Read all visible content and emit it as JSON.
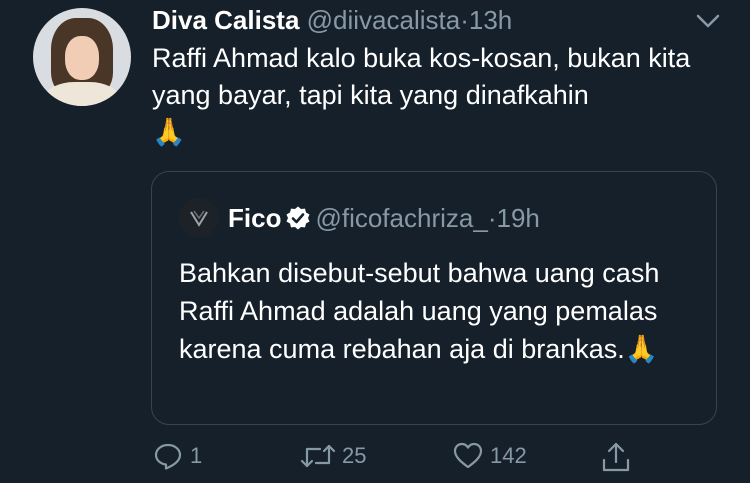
{
  "tweet": {
    "author_name": "Diva Calista",
    "author_handle": "@diivacalista",
    "separator": "·",
    "time": "13h",
    "text": "Raffi Ahmad kalo buka kos-kosan, bukan kita yang bayar, tapi kita yang dinafkahin",
    "emoji": "🙏"
  },
  "quoted": {
    "author_name": "Fico",
    "author_handle": "@ficofachriza_",
    "separator": "·",
    "time": "19h",
    "text": "Bahkan disebut-sebut bahwa uang cash Raffi Ahmad adalah uang yang pemalas karena cuma rebahan aja di brankas.",
    "emoji": "🙏"
  },
  "actions": {
    "reply_count": "1",
    "retweet_count": "25",
    "like_count": "142"
  },
  "colors": {
    "background": "#15202b",
    "secondary_text": "#8899a6",
    "border": "#38444d"
  },
  "icons": [
    "chevron-down-icon",
    "verified-badge-icon",
    "reply-icon",
    "retweet-icon",
    "like-icon",
    "share-icon"
  ]
}
